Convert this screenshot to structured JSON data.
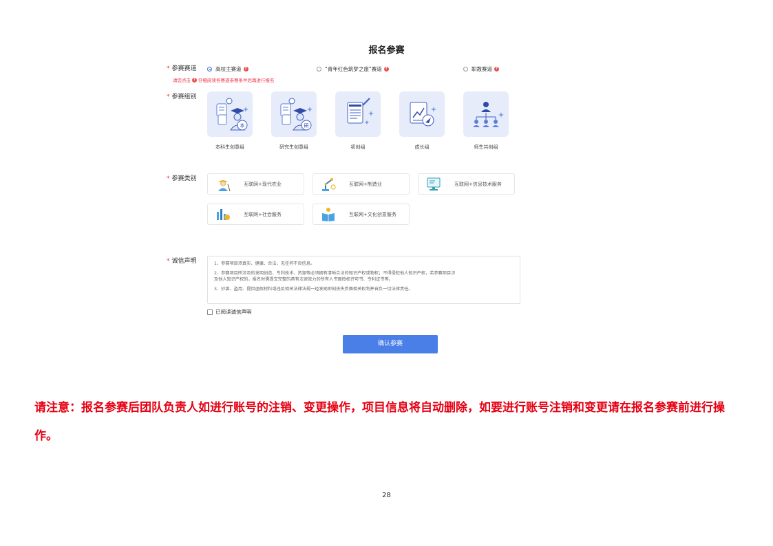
{
  "form": {
    "title": "报名参赛",
    "track": {
      "label": "参赛赛道",
      "options": [
        {
          "label": "高校主赛道",
          "selected": true
        },
        {
          "label": "“青年红色筑梦之旅”赛道",
          "selected": false
        },
        {
          "label": "职教赛道",
          "selected": false
        }
      ],
      "hint_prefix": "请您点击",
      "hint_suffix": "仔细阅读各赛道参赛条件后再进行报名"
    },
    "group": {
      "label": "参赛组别",
      "cards": [
        {
          "label": "本科生创意组",
          "icon": "undergraduate-icon"
        },
        {
          "label": "研究生创意组",
          "icon": "graduate-icon"
        },
        {
          "label": "初创组",
          "icon": "document-icon"
        },
        {
          "label": "成长组",
          "icon": "growth-chart-icon"
        },
        {
          "label": "师生共创组",
          "icon": "team-icon"
        }
      ]
    },
    "category": {
      "label": "参赛类别",
      "items": [
        {
          "label": "互联网+现代农业",
          "icon": "farmer-icon"
        },
        {
          "label": "互联网+制造业",
          "icon": "robot-arm-icon"
        },
        {
          "label": "互联网+信息技术服务",
          "icon": "monitor-icon"
        },
        {
          "label": "互联网+社会服务",
          "icon": "social-service-icon"
        },
        {
          "label": "互联网+文化创意服务",
          "icon": "culture-book-icon"
        }
      ]
    },
    "declaration": {
      "label": "诚信声明",
      "lines": [
        "1、参赛项目须真实、健康、合法，无任何不良信息。",
        "2、参赛项目所涉及的发明创造、专利技术、资源等必须拥有清晰合法的知识产权或物权；不得侵犯他人知识产权，若参赛项目涉",
        "及他人知识产权的，报名时需提交完整的具有法律效力的所有人书面授权许可书、专利证书等。",
        "3、抄袭、盗用、提供虚假材料或违反相关法律法规一经发现即刻丧失参赛相关权利并自负一切法律责任。"
      ],
      "checkbox_label": "已阅读诚信声明"
    },
    "confirm_label": "确认参赛"
  },
  "notice": "请注意：报名参赛后团队负责人如进行账号的注销、变更操作，项目信息将自动删除，如要进行账号注销和变更请在报名参赛前进行操作。",
  "page_number": "28",
  "colors": {
    "accent": "#4a7fe8",
    "required": "#e33333",
    "notice": "#e60012",
    "card_bg": "#e6ecfa"
  }
}
